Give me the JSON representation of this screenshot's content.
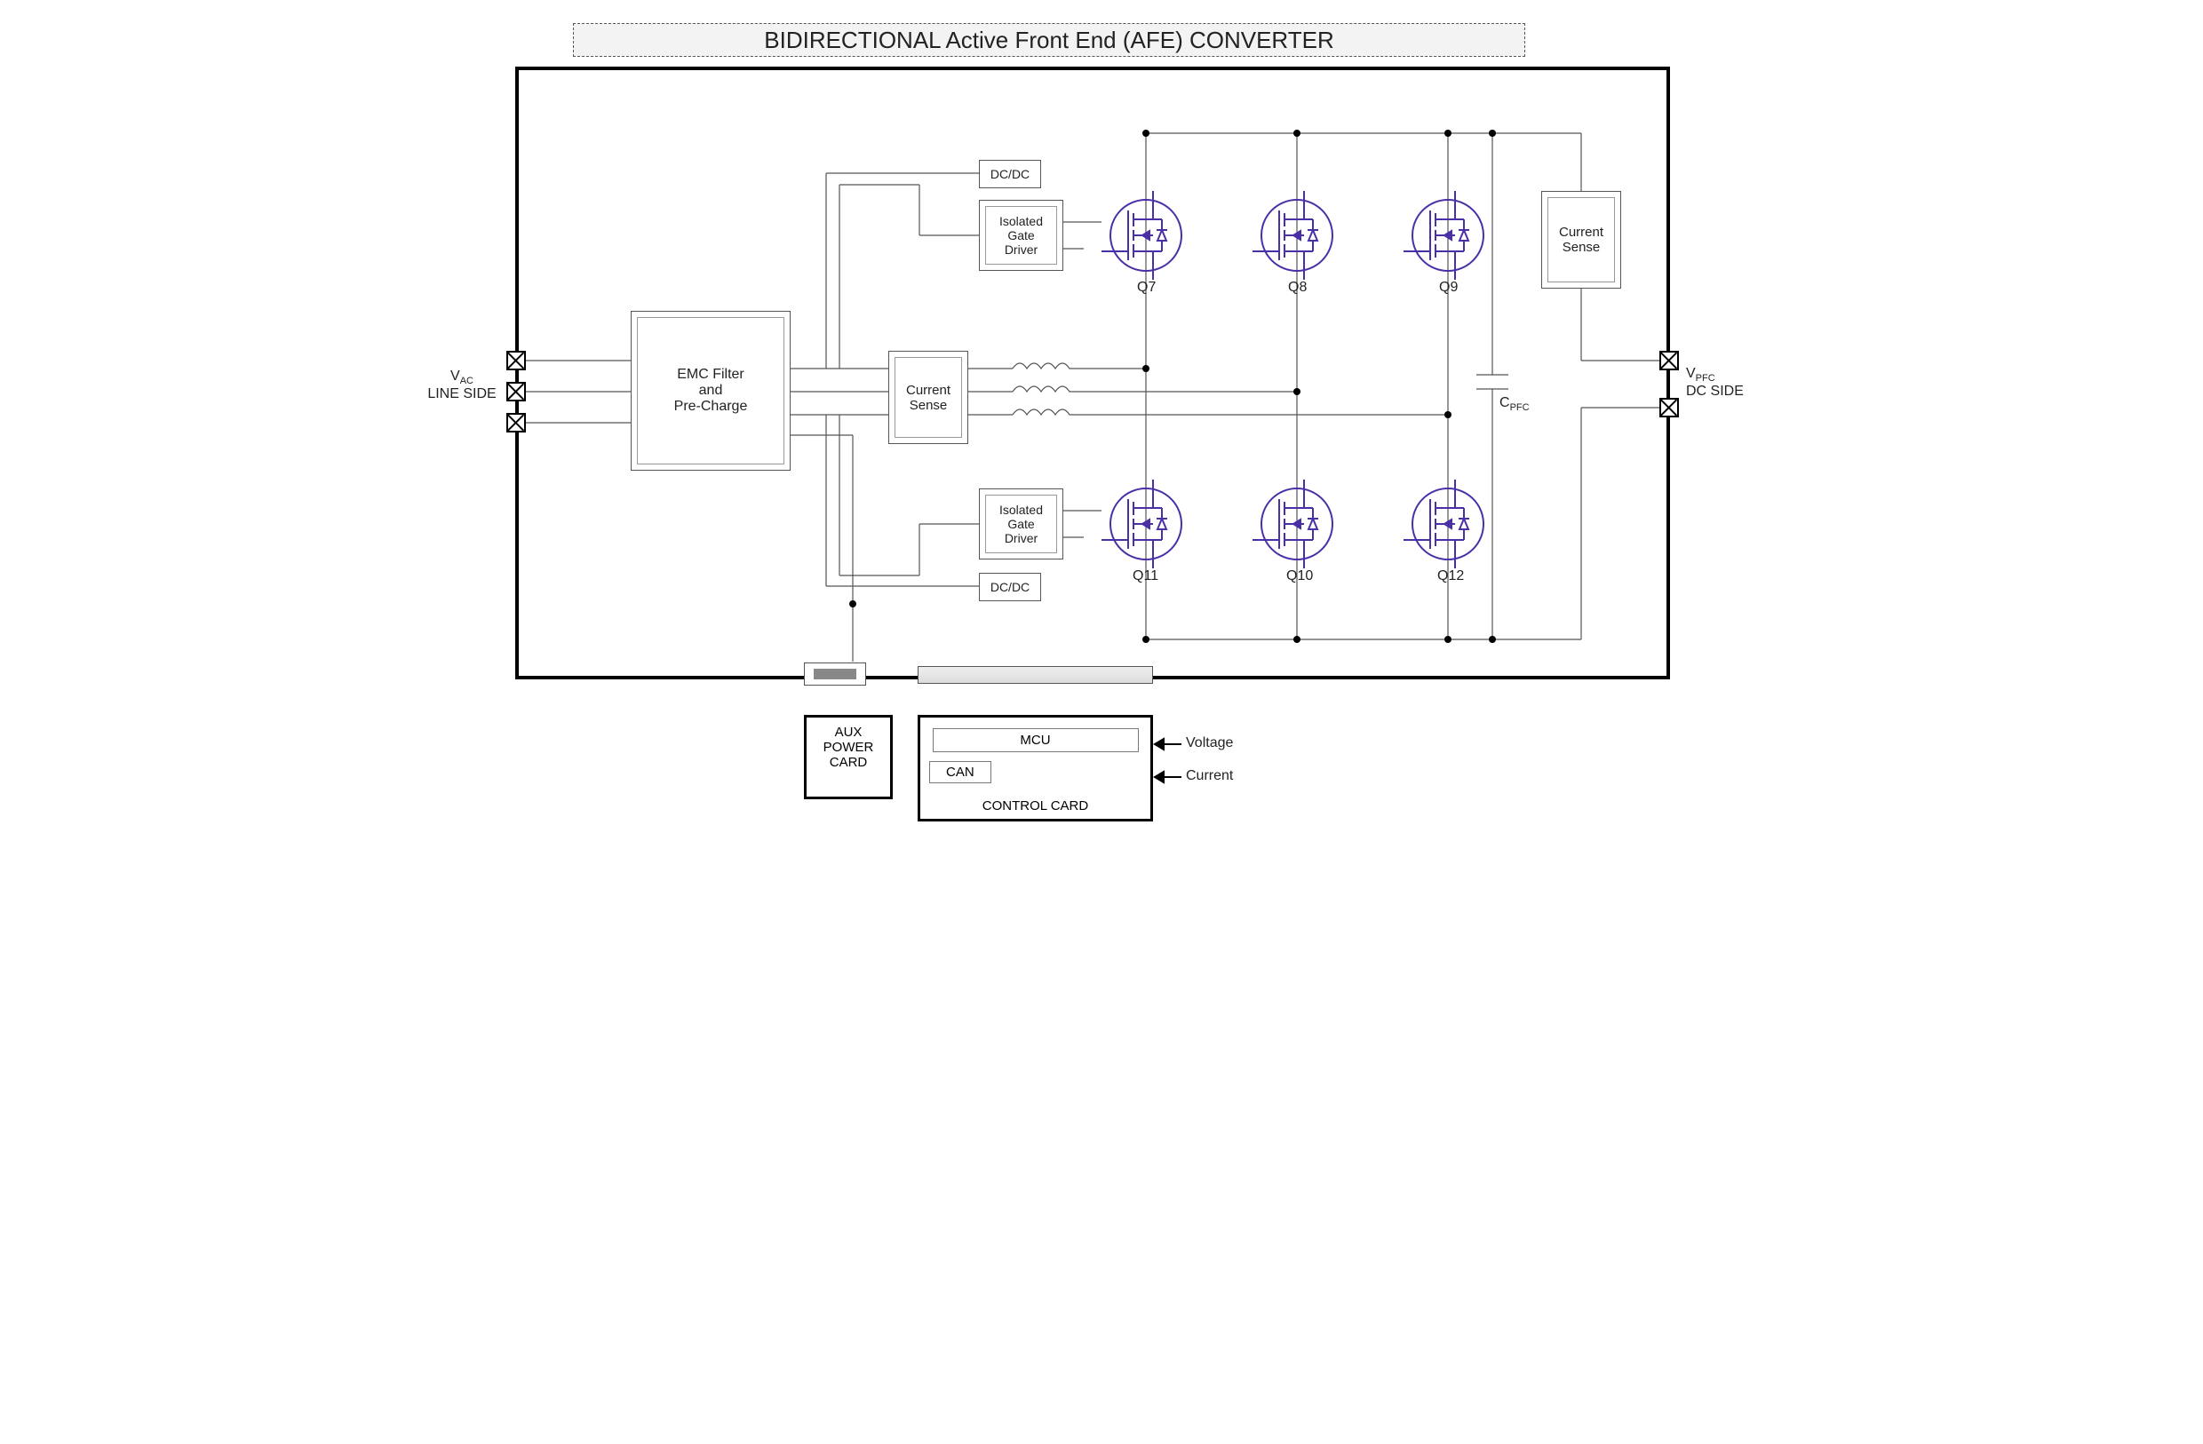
{
  "title": "BIDIRECTIONAL Active Front End (AFE) CONVERTER",
  "left_port": {
    "line1": "V",
    "sub": "AC",
    "line2": "LINE SIDE"
  },
  "right_port": {
    "line1": "V",
    "sub": "PFC",
    "line2": "DC SIDE"
  },
  "emc": "EMC Filter\nand\nPre-Charge",
  "csense": "Current\nSense",
  "csense_out": "Current\nSense",
  "dcdc": "DC/DC",
  "gate_driver": "Isolated\nGate\nDriver",
  "cap_label": {
    "c": "C",
    "sub": "PFC"
  },
  "q": {
    "q7": "Q7",
    "q8": "Q8",
    "q9": "Q9",
    "q10": "Q10",
    "q11": "Q11",
    "q12": "Q12"
  },
  "aux_card": "AUX\nPOWER\nCARD",
  "control_card": {
    "title": "CONTROL CARD",
    "mcu": "MCU",
    "can": "CAN"
  },
  "io": {
    "voltage": "Voltage",
    "current": "Current"
  }
}
